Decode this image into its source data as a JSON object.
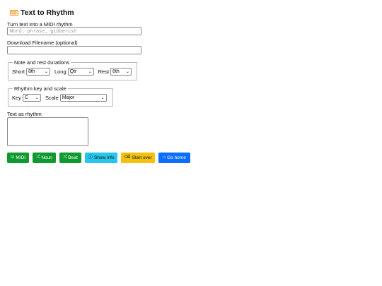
{
  "header": {
    "title": "Text to Rhythm",
    "icon": "keyboard-icon"
  },
  "text_input": {
    "label": "Turn text into a MIDI rhythm",
    "placeholder": "Word, phrase, gibberish",
    "value": ""
  },
  "filename": {
    "label": "Download Filename (optional)",
    "value": ""
  },
  "durations": {
    "legend": "Note and rest durations",
    "short_label": "Short",
    "short_value": "8th",
    "long_label": "Long",
    "long_value": "Qtr",
    "rest_label": "Rest",
    "rest_value": "8th"
  },
  "key_scale": {
    "legend": "Rhythm key and scale",
    "key_label": "Key",
    "key_value": "C",
    "scale_label": "Scale",
    "scale_value": "Major"
  },
  "rhythm_text": {
    "label": "Text as rhythm",
    "value": ""
  },
  "buttons": {
    "midi": "MIDI",
    "noun": "Noun",
    "beat": "Beat",
    "info": "Show info",
    "start_over": "Start over",
    "home": "Go home"
  },
  "colors": {
    "green": "#0e9a2e",
    "cyan": "#27c6ea",
    "yellow": "#f4c20d",
    "blue": "#0d6efd",
    "icon_orange": "#f0a030"
  }
}
